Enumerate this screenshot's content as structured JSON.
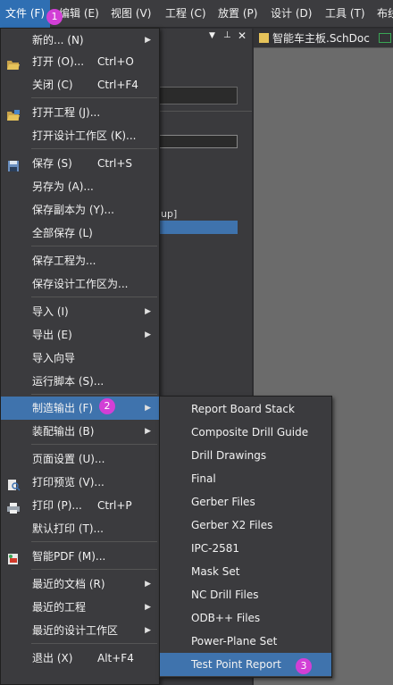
{
  "menubar": {
    "items": [
      "文件 (F)",
      "编辑 (E)",
      "视图 (V)",
      "工程 (C)",
      "放置 (P)",
      "设计 (D)",
      "工具 (T)",
      "布线"
    ]
  },
  "doc_tab": {
    "title": "智能车主板.SchDoc"
  },
  "panel": {
    "text_row": "up]"
  },
  "file_menu": {
    "items": [
      {
        "label": "新的... (N)",
        "shortcut": ""
      },
      {
        "label": "打开 (O)...",
        "shortcut": "Ctrl+O"
      },
      {
        "label": "关闭 (C)",
        "shortcut": "Ctrl+F4"
      },
      {
        "label": "打开工程 (J)...",
        "shortcut": ""
      },
      {
        "label": "打开设计工作区 (K)...",
        "shortcut": ""
      },
      {
        "label": "保存 (S)",
        "shortcut": "Ctrl+S"
      },
      {
        "label": "另存为 (A)...",
        "shortcut": ""
      },
      {
        "label": "保存副本为 (Y)...",
        "shortcut": ""
      },
      {
        "label": "全部保存 (L)",
        "shortcut": ""
      },
      {
        "label": "保存工程为...",
        "shortcut": ""
      },
      {
        "label": "保存设计工作区为...",
        "shortcut": ""
      },
      {
        "label": "导入 (I)",
        "shortcut": ""
      },
      {
        "label": "导出 (E)",
        "shortcut": ""
      },
      {
        "label": "导入向导",
        "shortcut": ""
      },
      {
        "label": "运行脚本 (S)...",
        "shortcut": ""
      },
      {
        "label": "制造输出 (F)",
        "shortcut": ""
      },
      {
        "label": "装配输出 (B)",
        "shortcut": ""
      },
      {
        "label": "页面设置 (U)...",
        "shortcut": ""
      },
      {
        "label": "打印预览 (V)...",
        "shortcut": ""
      },
      {
        "label": "打印 (P)...",
        "shortcut": "Ctrl+P"
      },
      {
        "label": "默认打印 (T)...",
        "shortcut": ""
      },
      {
        "label": "智能PDF (M)...",
        "shortcut": ""
      },
      {
        "label": "最近的文档 (R)",
        "shortcut": ""
      },
      {
        "label": "最近的工程",
        "shortcut": ""
      },
      {
        "label": "最近的设计工作区",
        "shortcut": ""
      },
      {
        "label": "退出 (X)",
        "shortcut": "Alt+F4"
      }
    ]
  },
  "fab_submenu": {
    "items": [
      "Report Board Stack",
      "Composite Drill Guide",
      "Drill Drawings",
      "Final",
      "Gerber Files",
      "Gerber X2 Files",
      "IPC-2581",
      "Mask Set",
      "NC Drill Files",
      "ODB++ Files",
      "Power-Plane Set",
      "Test Point Report"
    ]
  },
  "badges": [
    "1",
    "2",
    "3"
  ],
  "colors": {
    "highlight": "#3f73ad",
    "badge": "#d23fd6",
    "menu_bg": "#3b3b3e"
  }
}
